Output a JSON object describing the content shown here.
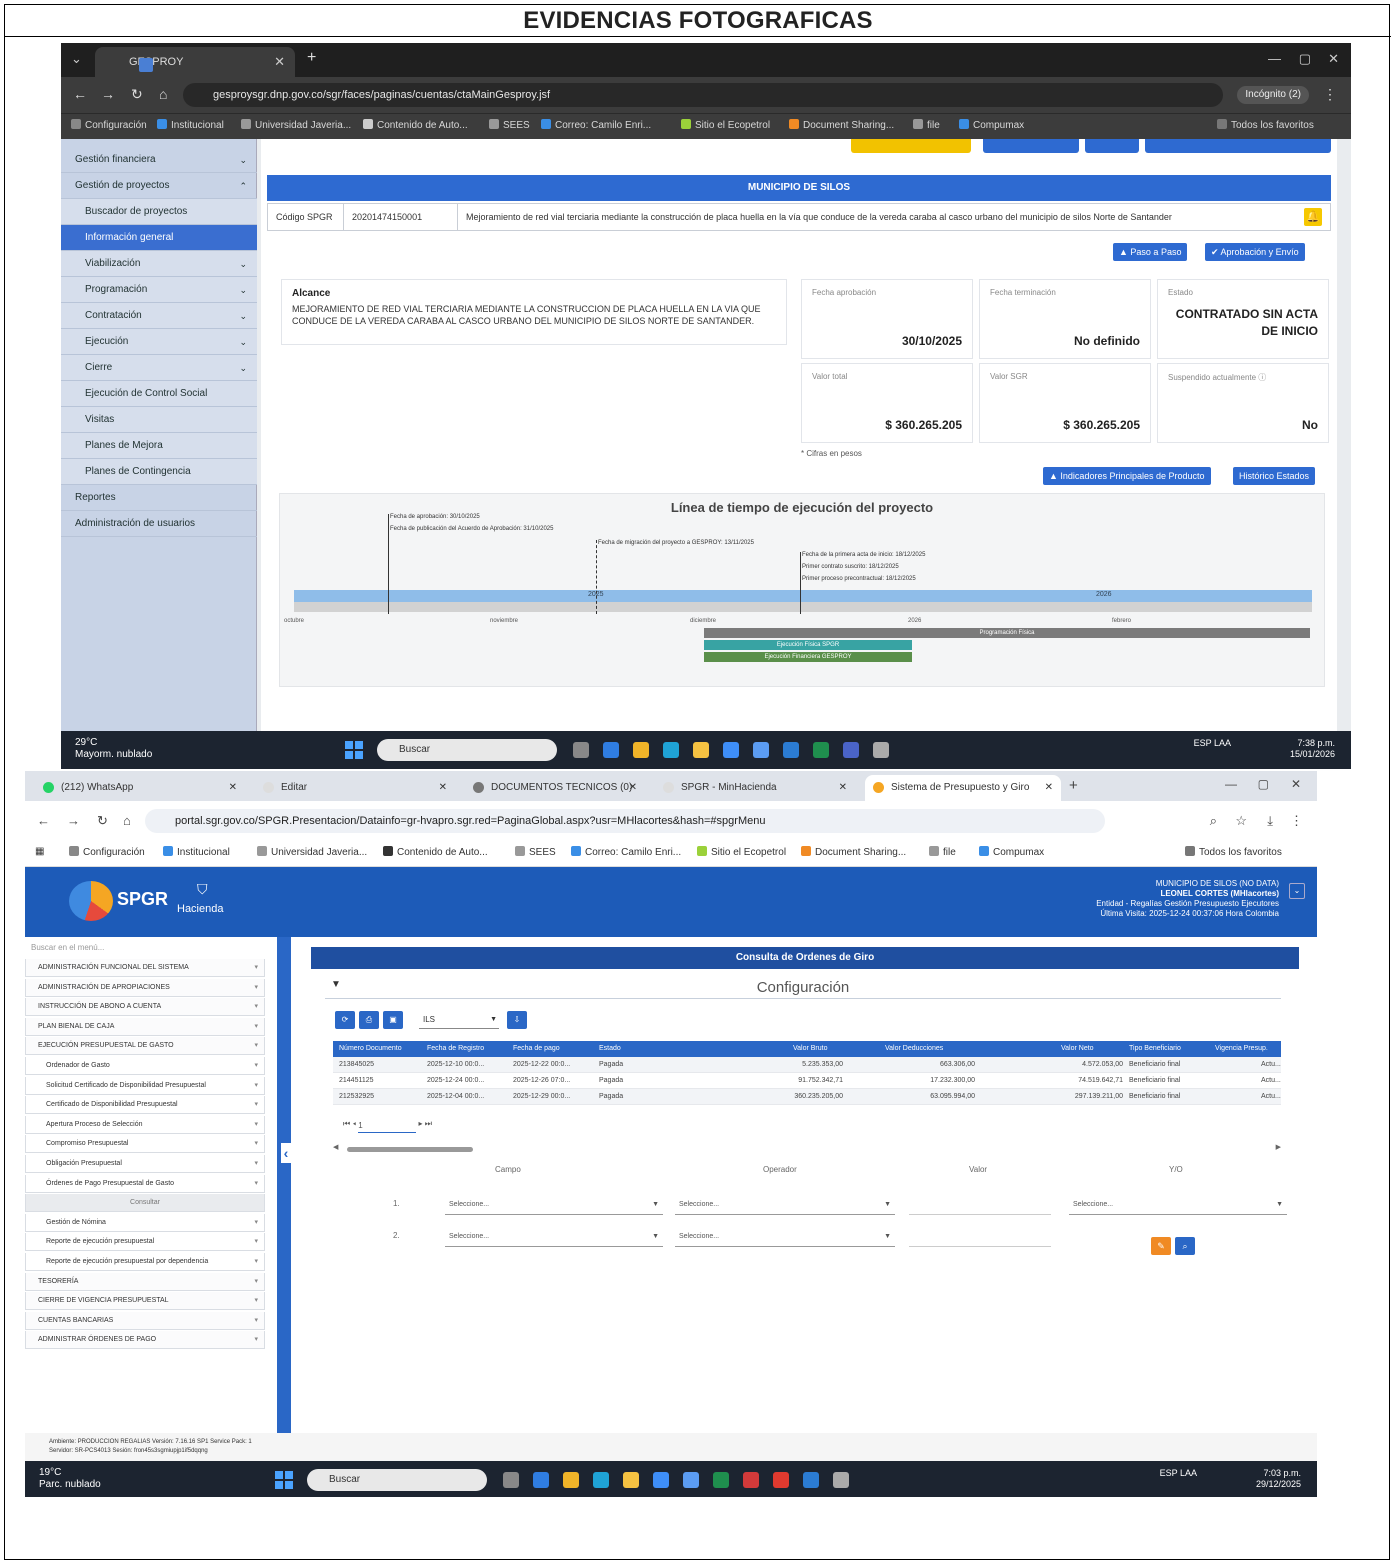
{
  "document": {
    "title": "EVIDENCIAS FOTOGRAFICAS"
  },
  "shot1": {
    "browser": {
      "tab_title": "GESPROY",
      "url": "gesproysgr.dnp.gov.co/sgr/faces/paginas/cuentas/ctaMainGesproy.jsf",
      "incognito_label": "Incógnito (2)",
      "bookmarks": [
        "Configuración",
        "Institucional",
        "Universidad Javeria...",
        "Contenido de Auto...",
        "SEES",
        "Correo: Camilo Enri...",
        "Sitio el Ecopetrol",
        "Document Sharing...",
        "file",
        "Compumax",
        "Todos los favoritos"
      ]
    },
    "sidebar": {
      "items": [
        {
          "label": "Gestión financiera",
          "sub": false,
          "active": false,
          "arrow": "⌄"
        },
        {
          "label": "Gestión de proyectos",
          "sub": false,
          "active": false,
          "arrow": "⌃"
        },
        {
          "label": "Buscador de proyectos",
          "sub": true,
          "active": false,
          "arrow": ""
        },
        {
          "label": "Información general",
          "sub": true,
          "active": true,
          "arrow": ""
        },
        {
          "label": "Viabilización",
          "sub": true,
          "active": false,
          "arrow": "⌄"
        },
        {
          "label": "Programación",
          "sub": true,
          "active": false,
          "arrow": "⌄"
        },
        {
          "label": "Contratación",
          "sub": true,
          "active": false,
          "arrow": "⌄"
        },
        {
          "label": "Ejecución",
          "sub": true,
          "active": false,
          "arrow": "⌄"
        },
        {
          "label": "Cierre",
          "sub": true,
          "active": false,
          "arrow": "⌄"
        },
        {
          "label": "Ejecución de Control Social",
          "sub": true,
          "active": false,
          "arrow": ""
        },
        {
          "label": "Visitas",
          "sub": true,
          "active": false,
          "arrow": ""
        },
        {
          "label": "Planes de Mejora",
          "sub": true,
          "active": false,
          "arrow": ""
        },
        {
          "label": "Planes de Contingencia",
          "sub": true,
          "active": false,
          "arrow": ""
        },
        {
          "label": "Reportes",
          "sub": false,
          "active": false,
          "arrow": ""
        },
        {
          "label": "Administración de usuarios",
          "sub": false,
          "active": false,
          "arrow": ""
        }
      ]
    },
    "project": {
      "municipio": "MUNICIPIO DE SILOS",
      "codigo_label": "Código SPGR",
      "codigo_value": "20201474150001",
      "nombre": "Mejoramiento de red vial terciaria mediante la construcción de placa huella en la vía que conduce de la vereda caraba al casco urbano del municipio de silos Norte de Santander",
      "btn_paso": "Paso a Paso",
      "btn_aprob": "Aprobación y Envío",
      "alcance_title": "Alcance",
      "alcance_text": "MEJORAMIENTO DE RED VIAL TERCIARIA MEDIANTE LA CONSTRUCCION DE PLACA HUELLA EN LA VIA QUE CONDUCE DE LA VEREDA CARABA AL CASCO URBANO DEL MUNICIPIO DE SILOS NORTE DE SANTANDER.",
      "cards": {
        "fecha_aprob_label": "Fecha aprobación",
        "fecha_aprob_value": "30/10/2025",
        "fecha_term_label": "Fecha terminación",
        "fecha_term_value": "No definido",
        "estado_label": "Estado",
        "estado_value": "CONTRATADO SIN ACTA DE INICIO",
        "valor_total_label": "Valor total",
        "valor_total_value": "$ 360.265.205",
        "valor_sgr_label": "Valor SGR",
        "valor_sgr_value": "$ 360.265.205",
        "suspendido_label": "Suspendido actualmente",
        "suspendido_value": "No"
      },
      "cifras_note": "* Cifras en pesos",
      "btn_indicadores": "Indicadores Principales de Producto",
      "btn_historico": "Histórico Estados"
    },
    "timeline": {
      "title": "Línea de tiempo de ejecución del proyecto",
      "events": [
        "Fecha de aprobación: 30/10/2025",
        "Fecha de publicación del Acuerdo de Aprobación: 31/10/2025",
        "Fecha de migración del proyecto a GESPROY: 13/11/2025",
        "Fecha de la primera acta de inicio: 18/12/2025",
        "Primer contrato suscrito: 18/12/2025",
        "Primer proceso precontractual: 18/12/2025"
      ],
      "year_labels": [
        "2025",
        "2026"
      ],
      "axis_labels": [
        "octubre",
        "noviembre",
        "diciembre",
        "2026",
        "febrero"
      ],
      "bars": [
        "Programación Física",
        "Ejecución Física SPGR",
        "Ejecución Financiera GESPROY"
      ]
    },
    "taskbar": {
      "temp": "29°C",
      "weather": "Mayorm. nublado",
      "search": "Buscar",
      "lang": "ESP LAA",
      "time": "7:38 p.m.",
      "date": "15/01/2026"
    }
  },
  "shot2": {
    "tabs": [
      {
        "label": "(212) WhatsApp",
        "active": false
      },
      {
        "label": "Editar",
        "active": false
      },
      {
        "label": "DOCUMENTOS TECNICOS (0)",
        "active": false
      },
      {
        "label": "SPGR - MinHacienda",
        "active": false
      },
      {
        "label": "Sistema de Presupuesto y Giro",
        "active": true
      }
    ],
    "url": "portal.sgr.gov.co/SPGR.Presentacion/Datainfo=gr-hvapro.sgr.red=PaginaGlobal.aspx?usr=MHlacortes&hash=#spgrMenu",
    "app": {
      "logo": "SPGR",
      "hacienda": "Hacienda",
      "user_line1": "MUNICIPIO DE SILOS (NO DATA)",
      "user_line2": "LEONEL CORTES (MHlacortes)",
      "user_line3": "Entidad - Regalías Gestión Presupuesto Ejecutores",
      "user_line4": "Última Visita: 2025-12-24 00:37:06 Hora Colombia"
    },
    "sidebar": {
      "search": "Buscar en el menú...",
      "items": [
        {
          "label": "ADMINISTRACIÓN FUNCIONAL DEL SISTEMA",
          "kind": "top"
        },
        {
          "label": "ADMINISTRACIÓN DE APROPIACIONES",
          "kind": "top"
        },
        {
          "label": "INSTRUCCIÓN DE ABONO A CUENTA",
          "kind": "top"
        },
        {
          "label": "PLAN BIENAL DE CAJA",
          "kind": "top"
        },
        {
          "label": "EJECUCIÓN PRESUPUESTAL DE GASTO",
          "kind": "top"
        },
        {
          "label": "Ordenador de Gasto",
          "kind": "sub"
        },
        {
          "label": "Solicitud Certificado de Disponibilidad Presupuestal",
          "kind": "sub"
        },
        {
          "label": "Certificado de Disponibilidad Presupuestal",
          "kind": "sub"
        },
        {
          "label": "Apertura Proceso de Selección",
          "kind": "sub"
        },
        {
          "label": "Compromiso Presupuestal",
          "kind": "sub"
        },
        {
          "label": "Obligación Presupuestal",
          "kind": "sub"
        },
        {
          "label": "Órdenes de Pago Presupuestal de Gasto",
          "kind": "sub"
        },
        {
          "label": "Consultar",
          "kind": "sel"
        },
        {
          "label": "Gestión de Nómina",
          "kind": "sub"
        },
        {
          "label": "Reporte de ejecución presupuestal",
          "kind": "sub"
        },
        {
          "label": "Reporte de ejecución presupuestal por dependencia",
          "kind": "sub"
        },
        {
          "label": "TESORERÍA",
          "kind": "top"
        },
        {
          "label": "CIERRE DE VIGENCIA PRESUPUESTAL",
          "kind": "top"
        },
        {
          "label": "CUENTAS BANCARIAS",
          "kind": "top"
        },
        {
          "label": "ADMINISTRAR ÓRDENES DE PAGO",
          "kind": "top"
        }
      ]
    },
    "main": {
      "band": "Consulta de Ordenes de Giro",
      "config_title": "Configuración",
      "select_value": "ILS",
      "grid": {
        "columns": [
          "Número Documento",
          "Fecha de Registro",
          "Fecha de pago",
          "Estado",
          "Valor Bruto",
          "Valor Deducciones",
          "Valor Neto",
          "Tipo Beneficiario",
          "Vigencia Presup."
        ],
        "rows": [
          [
            "213845025",
            "2025-12-10 00:0...",
            "2025-12-22 00:0...",
            "Pagada",
            "5.235.353,00",
            "663.306,00",
            "4.572.053,00",
            "Beneficiario final",
            "Actu..."
          ],
          [
            "214451125",
            "2025-12-24 00:0...",
            "2025-12-26 07:0...",
            "Pagada",
            "91.752.342,71",
            "17.232.300,00",
            "74.519.642,71",
            "Beneficiario final",
            "Actu..."
          ],
          [
            "212532925",
            "2025-12-04 00:0...",
            "2025-12-29 00:0...",
            "Pagada",
            "360.235.205,00",
            "63.095.994,00",
            "297.139.211,00",
            "Beneficiario final",
            "Actu..."
          ]
        ]
      },
      "pager_page": "1",
      "filter_headers": [
        "Campo",
        "Operador",
        "Valor",
        "Y/O"
      ],
      "filter_placeholder": "Seleccione..."
    },
    "status_line1": "Ambiente: PRODUCCION REGALIAS Versión: 7.16.16 SP1 Service Pack: 1",
    "status_line2": "Servidor: SR-PCS4013 Sesión: fron45s3sgmiupjp1if5dqqng",
    "taskbar": {
      "temp": "19°C",
      "weather": "Parc. nublado",
      "search": "Buscar",
      "lang": "ESP LAA",
      "time": "7:03 p.m.",
      "date": "29/12/2025"
    }
  }
}
